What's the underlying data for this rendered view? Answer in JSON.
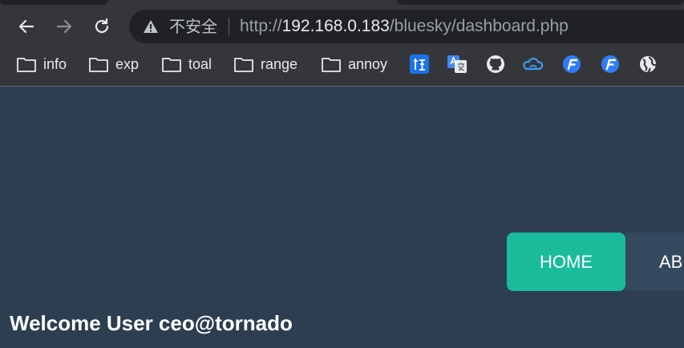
{
  "browser": {
    "security_label": "不安全",
    "url": {
      "scheme": "http://",
      "host": "192.168.0.183",
      "path": "/bluesky/dashboard.php"
    },
    "bookmarks": [
      {
        "label": "info",
        "icon": "folder-icon"
      },
      {
        "label": "exp",
        "icon": "folder-icon"
      },
      {
        "label": "toal",
        "icon": "folder-icon"
      },
      {
        "label": "range",
        "icon": "folder-icon"
      },
      {
        "label": "annoy",
        "icon": "folder-icon"
      }
    ],
    "bookmark_icons": [
      "translate-icon",
      "google-translate-icon",
      "github-icon",
      "cloud-icon",
      "fp-icon",
      "fp-icon",
      "globe-icon"
    ]
  },
  "page": {
    "nav": {
      "home": "HOME",
      "about": "AB"
    },
    "welcome": "Welcome User ceo@tornado"
  },
  "colors": {
    "page_bg": "#2c3e50",
    "nav_active": "#1abc9c",
    "nav_inactive": "#34495e"
  }
}
